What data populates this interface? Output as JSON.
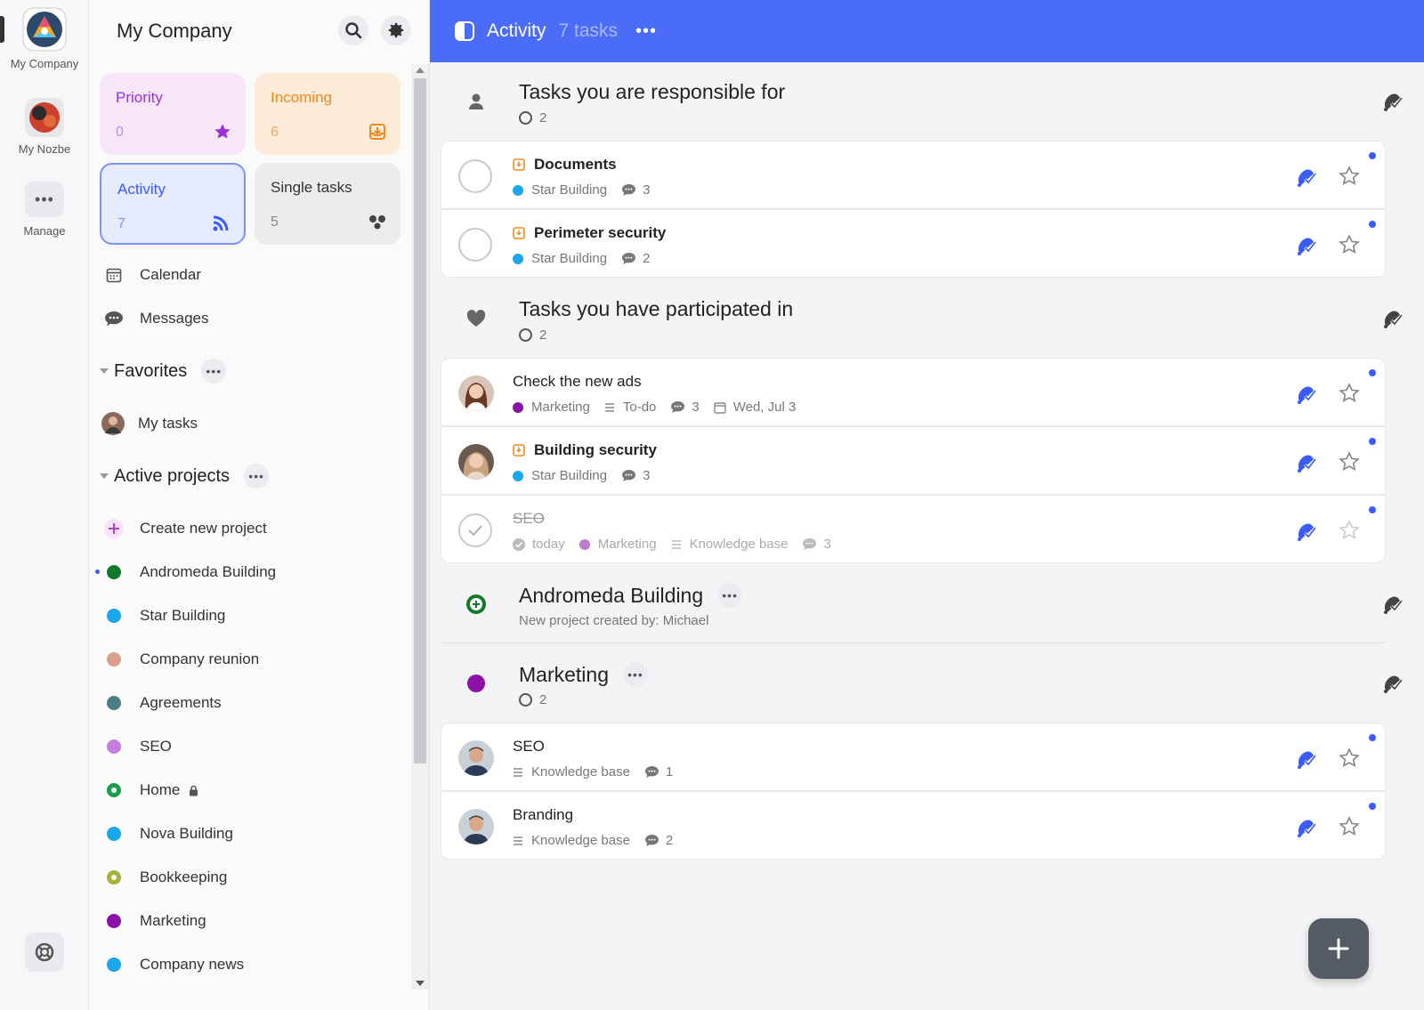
{
  "rail": {
    "items": [
      {
        "label": "My Company"
      },
      {
        "label": "My Nozbe"
      },
      {
        "label": "Manage"
      }
    ]
  },
  "sidebar": {
    "title": "My Company",
    "cards": [
      {
        "title": "Priority",
        "count": "0",
        "color": "#9b30d9",
        "bg": "#f7e6f8"
      },
      {
        "title": "Incoming",
        "count": "6",
        "color": "#f08a1c",
        "bg": "#fcebd9"
      },
      {
        "title": "Activity",
        "count": "7",
        "color": "#3b5bf5",
        "bg": "#e6ebfd"
      },
      {
        "title": "Single tasks",
        "count": "5",
        "color": "#444444",
        "bg": "#ececef"
      }
    ],
    "nav": [
      {
        "label": "Calendar"
      },
      {
        "label": "Messages"
      }
    ],
    "favorites": {
      "label": "Favorites",
      "items": [
        {
          "label": "My tasks"
        }
      ]
    },
    "projects": {
      "label": "Active projects",
      "create_label": "Create new project",
      "items": [
        {
          "label": "Andromeda Building",
          "color": "#137a2c"
        },
        {
          "label": "Star Building",
          "color": "#1aa7ec"
        },
        {
          "label": "Company reunion",
          "color": "#d9a08e"
        },
        {
          "label": "Agreements",
          "color": "#4a7f82"
        },
        {
          "label": "SEO",
          "color": "#c77ce0"
        },
        {
          "label": "Home",
          "color": "#1a9c4a"
        },
        {
          "label": "Nova Building",
          "color": "#1aa7ec"
        },
        {
          "label": "Bookkeeping",
          "color": "#a6b23c"
        },
        {
          "label": "Marketing",
          "color": "#8a12a6"
        },
        {
          "label": "Company news",
          "color": "#1aa7ec"
        }
      ]
    }
  },
  "main": {
    "title": "Activity",
    "count": "7 tasks",
    "groups": [
      {
        "title": "Tasks you are responsible for",
        "sub": "2"
      },
      {
        "title": "Tasks you have participated in",
        "sub": "2"
      },
      {
        "title": "Andromeda Building",
        "sub": "New project created by: Michael"
      },
      {
        "title": "Marketing",
        "sub": "2"
      }
    ],
    "tasks": [
      {
        "name": "Documents",
        "project": "Star Building",
        "comments": "3"
      },
      {
        "name": "Perimeter security",
        "project": "Star Building",
        "comments": "2"
      },
      {
        "name": "Check the new ads",
        "project": "Marketing",
        "section": "To-do",
        "comments": "3",
        "date": "Wed, Jul 3"
      },
      {
        "name": "Building security",
        "project": "Star Building",
        "comments": "3"
      },
      {
        "name": "SEO",
        "when": "today",
        "project": "Marketing",
        "section": "Knowledge base",
        "comments": "3"
      },
      {
        "name": "SEO",
        "section": "Knowledge base",
        "comments": "1"
      },
      {
        "name": "Branding",
        "section": "Knowledge base",
        "comments": "2"
      }
    ]
  },
  "colors": {
    "accent": "#4a6cf7",
    "bell": "#3b5bf5",
    "star_building": "#1aa7ec",
    "marketing": "#8a12a6",
    "incoming": "#f08a1c"
  }
}
